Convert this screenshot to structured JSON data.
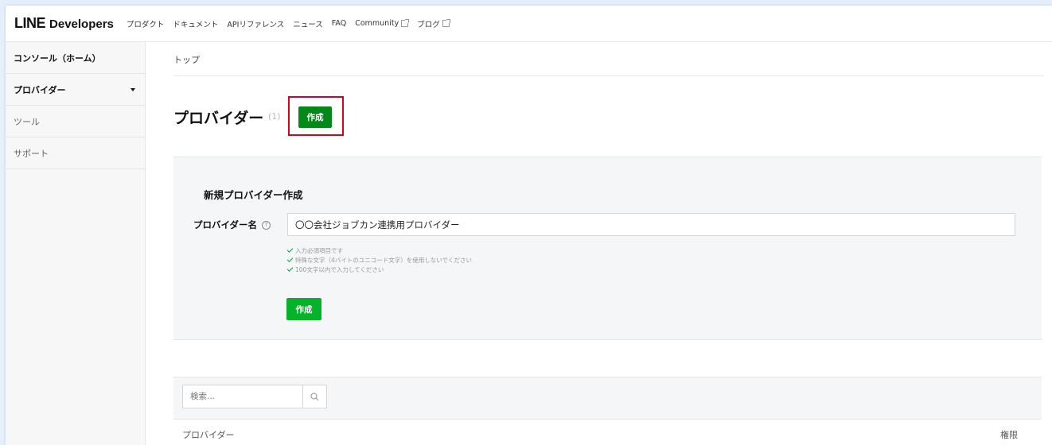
{
  "header": {
    "logo_line": "LINE",
    "logo_developers": "Developers",
    "nav": [
      {
        "label": "プロダクト",
        "external": false
      },
      {
        "label": "ドキュメント",
        "external": false
      },
      {
        "label": "APIリファレンス",
        "external": false
      },
      {
        "label": "ニュース",
        "external": false
      },
      {
        "label": "FAQ",
        "external": false
      },
      {
        "label": "Community",
        "external": true
      },
      {
        "label": "ブログ",
        "external": true
      }
    ]
  },
  "sidebar": {
    "items": [
      {
        "label": "コンソール（ホーム）"
      },
      {
        "label": "プロバイダー"
      },
      {
        "label": "ツール"
      },
      {
        "label": "サポート"
      }
    ]
  },
  "main": {
    "breadcrumb": "トップ",
    "title": "プロバイダー",
    "count": "(1)",
    "create_button": "作成",
    "form": {
      "heading": "新規プロバイダー作成",
      "field_label": "プロバイダー名",
      "help_icon": "?",
      "field_value": "〇〇会社ジョブカン連携用プロバイダー",
      "validations": [
        "入力必須項目です",
        "特殊な文字（4バイトのユニコード文字）を使用しないでください",
        "100文字以内で入力してください"
      ],
      "submit_label": "作成"
    },
    "list": {
      "search_placeholder": "検索...",
      "column_provider": "プロバイダー",
      "column_permission": "権限"
    }
  },
  "colors": {
    "accent_green": "#06b22a",
    "dark_green": "#05881a",
    "highlight_red": "#d9001b"
  }
}
